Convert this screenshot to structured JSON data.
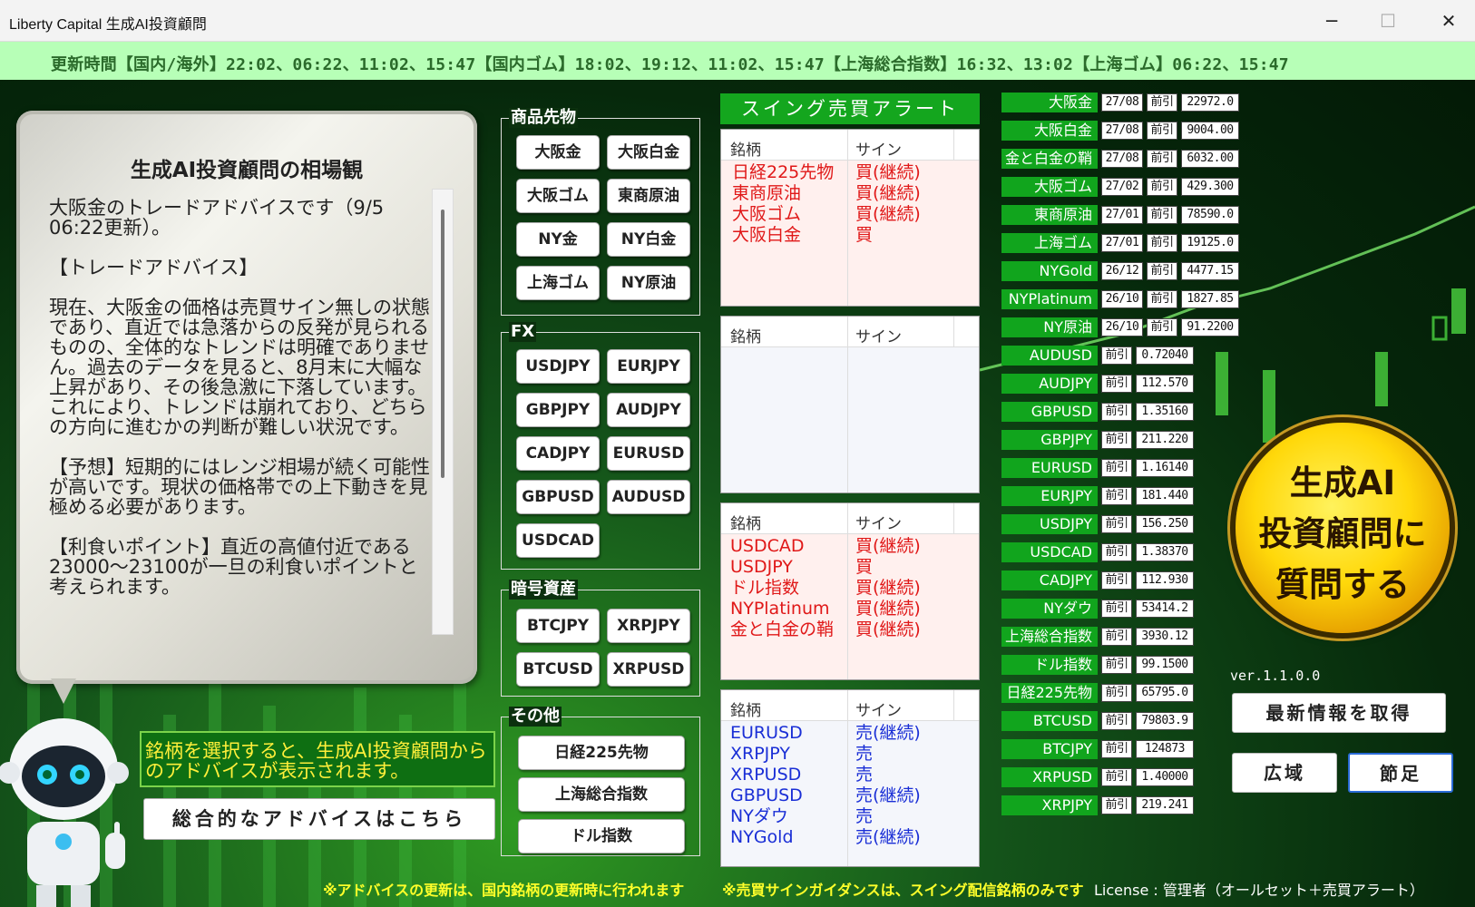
{
  "window": {
    "title": "Liberty Capital 生成AI投資顧問",
    "minimize": "─",
    "maximize": "☐",
    "close": "✕"
  },
  "ticker": "更新時間【国内/海外】22:02、06:22、11:02、15:47【国内ゴム】18:02、19:12、11:02、15:47【上海総合指数】16:32、13:02【上海ゴム】06:22、15:47",
  "advice": {
    "title": "生成AI投資顧問の相場観",
    "text": "大阪金のトレードアドバイスです（9/5 06:22更新）。\n\n【トレードアドバイス】\n\n現在、大阪金の価格は売買サイン無しの状態であり、直近では急落からの反発が見られるものの、全体的なトレンドは明確でありません。過去のデータを見ると、8月末に大幅な上昇があり、その後急激に下落しています。これにより、トレンドは崩れており、どちらの方向に進むかの判断が難しい状況です。\n\n【予想】短期的にはレンジ相場が続く可能性が高いです。現状の価格帯での上下動きを見極める必要があります。\n\n【利食いポイント】直近の高値付近である23000〜23100が一旦の利食いポイントと考えられます。"
  },
  "groups": {
    "commodity": {
      "label": "商品先物",
      "buttons": [
        "大阪金",
        "大阪白金",
        "大阪ゴム",
        "東商原油",
        "NY金",
        "NY白金",
        "上海ゴム",
        "NY原油"
      ]
    },
    "fx": {
      "label": "FX",
      "buttons": [
        "USDJPY",
        "EURJPY",
        "GBPJPY",
        "AUDJPY",
        "CADJPY",
        "EURUSD",
        "GBPUSD",
        "AUDUSD",
        "USDCAD"
      ]
    },
    "crypto": {
      "label": "暗号資産",
      "buttons": [
        "BTCJPY",
        "XRPJPY",
        "BTCUSD",
        "XRPUSD"
      ]
    },
    "other": {
      "label": "その他",
      "buttons": [
        "日経225先物",
        "上海総合指数",
        "ドル指数"
      ]
    }
  },
  "alerts": {
    "title": "スイング売買アラート",
    "col_name": "銘柄",
    "col_sign": "サイン",
    "panel1": [
      {
        "name": "日経225先物",
        "sign": "買(継続)"
      },
      {
        "name": "東商原油",
        "sign": "買(継続)"
      },
      {
        "name": "大阪ゴム",
        "sign": "買(継続)"
      },
      {
        "name": "大阪白金",
        "sign": "買"
      }
    ],
    "panel2": [],
    "panel3": [
      {
        "name": "USDCAD",
        "sign": "買(継続)"
      },
      {
        "name": "USDJPY",
        "sign": "買"
      },
      {
        "name": "ドル指数",
        "sign": "買(継続)"
      },
      {
        "name": "NYPlatinum",
        "sign": "買(継続)"
      },
      {
        "name": "金と白金の鞘",
        "sign": "買(継続)"
      }
    ],
    "panel4": [
      {
        "name": "EURUSD",
        "sign": "売(継続)"
      },
      {
        "name": "XRPJPY",
        "sign": "売"
      },
      {
        "name": "XRPUSD",
        "sign": "売"
      },
      {
        "name": "GBPUSD",
        "sign": "売(継続)"
      },
      {
        "name": "NYダウ",
        "sign": "売"
      },
      {
        "name": "NYGold",
        "sign": "売(継続)"
      }
    ],
    "colors": {
      "buy": "#e01818",
      "sell": "#1a2fd6"
    }
  },
  "quotes": [
    {
      "name": "大阪金",
      "month": "27/08",
      "label": "前引",
      "value": "22972.0"
    },
    {
      "name": "大阪白金",
      "month": "27/08",
      "label": "前引",
      "value": "9004.00"
    },
    {
      "name": "金と白金の鞘",
      "month": "27/08",
      "label": "前引",
      "value": "6032.00"
    },
    {
      "name": "大阪ゴム",
      "month": "27/02",
      "label": "前引",
      "value": "429.300"
    },
    {
      "name": "東商原油",
      "month": "27/01",
      "label": "前引",
      "value": "78590.0"
    },
    {
      "name": "上海ゴム",
      "month": "27/01",
      "label": "前引",
      "value": "19125.0"
    },
    {
      "name": "NYGold",
      "month": "26/12",
      "label": "前引",
      "value": "4477.15"
    },
    {
      "name": "NYPlatinum",
      "month": "26/10",
      "label": "前引",
      "value": "1827.85"
    },
    {
      "name": "NY原油",
      "month": "26/10",
      "label": "前引",
      "value": "91.2200"
    },
    {
      "name": "AUDUSD",
      "label": "前引",
      "value": "0.72040"
    },
    {
      "name": "AUDJPY",
      "label": "前引",
      "value": "112.570"
    },
    {
      "name": "GBPUSD",
      "label": "前引",
      "value": "1.35160"
    },
    {
      "name": "GBPJPY",
      "label": "前引",
      "value": "211.220"
    },
    {
      "name": "EURUSD",
      "label": "前引",
      "value": "1.16140"
    },
    {
      "name": "EURJPY",
      "label": "前引",
      "value": "181.440"
    },
    {
      "name": "USDJPY",
      "label": "前引",
      "value": "156.250"
    },
    {
      "name": "USDCAD",
      "label": "前引",
      "value": "1.38370"
    },
    {
      "name": "CADJPY",
      "label": "前引",
      "value": "112.930"
    },
    {
      "name": "NYダウ",
      "label": "前引",
      "value": "53414.2"
    },
    {
      "name": "上海総合指数",
      "label": "前引",
      "value": "3930.12"
    },
    {
      "name": "ドル指数",
      "label": "前引",
      "value": "99.1500"
    },
    {
      "name": "日経225先物",
      "label": "前引",
      "value": "65795.0"
    },
    {
      "name": "BTCUSD",
      "label": "前引",
      "value": "79803.9"
    },
    {
      "name": "BTCJPY",
      "label": "前引",
      "value": "124873"
    },
    {
      "name": "XRPUSD",
      "label": "前引",
      "value": "1.40000"
    },
    {
      "name": "XRPJPY",
      "label": "前引",
      "value": "219.241"
    }
  ],
  "ask_button": {
    "line1": "生成AI",
    "line2": "投資顧問に",
    "line3": "質問する"
  },
  "version": "ver.1.1.0.0",
  "buttons": {
    "fetch": "最新情報を取得",
    "wide": "広域",
    "sekiashi": "節足"
  },
  "hint": "銘柄を選択すると、生成AI投資顧問からのアドバイスが表示されます。",
  "overall_advice": "総合的なアドバイスはこちら",
  "footer": {
    "note1": "※アドバイスの更新は、国内銘柄の更新時に行われます",
    "note2": "※売買サインガイダンスは、スイング配信銘柄のみです",
    "license": "License : 管理者（オールセット＋売買アラート）"
  }
}
